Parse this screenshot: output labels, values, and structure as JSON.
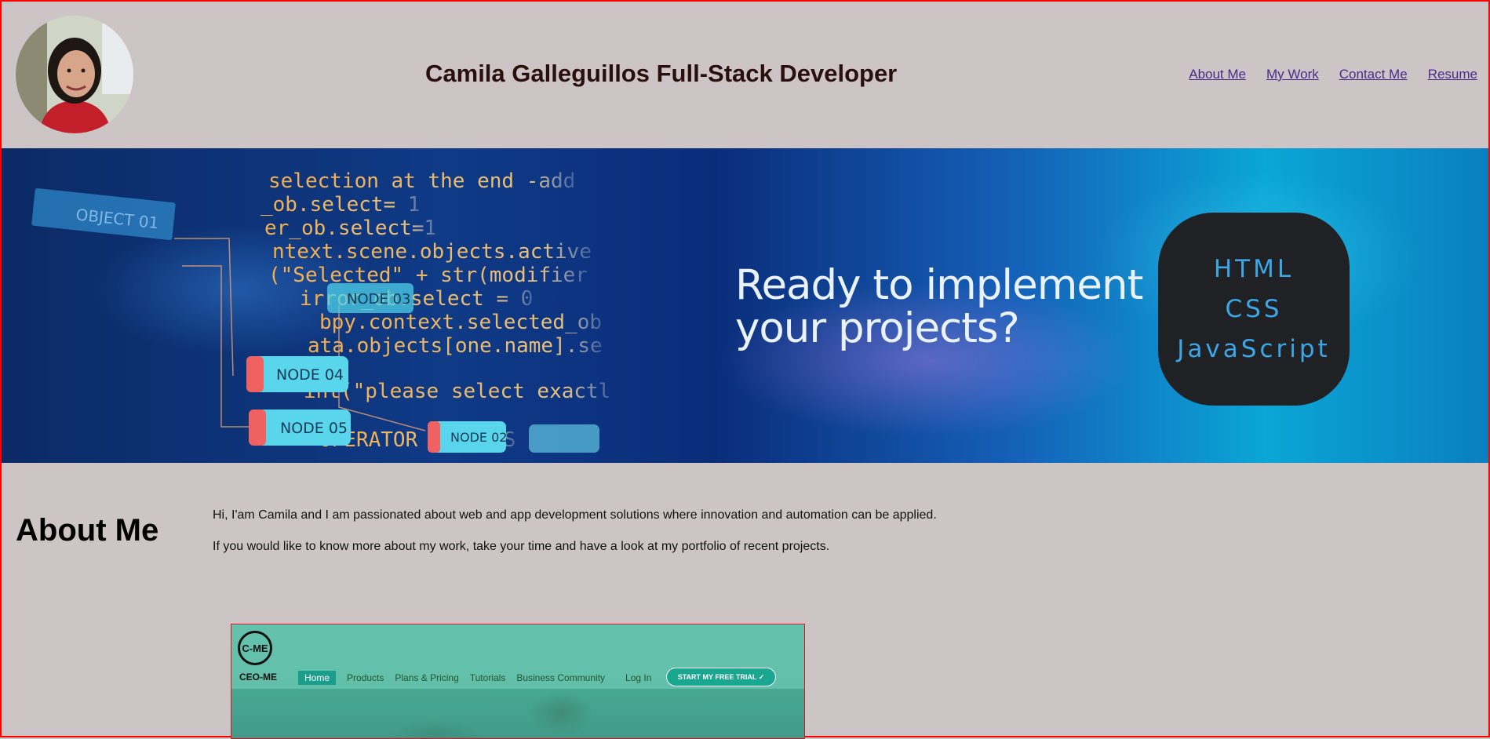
{
  "header": {
    "title": "Camila Galleguillos Full-Stack Developer",
    "avatar_icon": "profile-photo",
    "nav": [
      {
        "label": "About Me"
      },
      {
        "label": "My Work"
      },
      {
        "label": "Contact Me"
      },
      {
        "label": "Resume"
      }
    ]
  },
  "hero": {
    "headline": "Ready to implement your projects?",
    "skills": [
      "HTML",
      "CSS",
      "JavaScript"
    ],
    "code_lines": [
      "selection at the end -add",
      "_ob.select= 1",
      "er_ob.select=1",
      "ntext.scene.objects.active",
      "(\"Selected\" + str(modifier",
      "irror_ob.select = 0",
      "bpy.context.selected_ob",
      "ata.objects[one.name].se",
      "int(\"please select exactl",
      "OPERATOR CLASSES"
    ],
    "nodes": [
      "OBJECT 01",
      "NODE 03",
      "NODE 04",
      "NODE 05",
      "NODE 02"
    ]
  },
  "about": {
    "heading": "About Me",
    "paragraphs": [
      "Hi, I'am Camila and I am passionated about web and app development solutions where innovation and automation can be applied.",
      "If you would like to know more about my work, take your time and have a look at my portfolio of recent projects."
    ]
  },
  "project_preview": {
    "logo_text": "C-ME",
    "brand": "CEO-ME",
    "menu": [
      "Home",
      "Products",
      "Plans & Pricing",
      "Tutorials",
      "Business Community",
      "Log In"
    ],
    "cta": "START MY FREE TRIAL ✓"
  },
  "colors": {
    "background": "#cdc5c5",
    "title": "#2a0f0f",
    "link": "#4b2a8a",
    "badge_bg": "#1f2124",
    "badge_text": "#3ba7e6"
  }
}
